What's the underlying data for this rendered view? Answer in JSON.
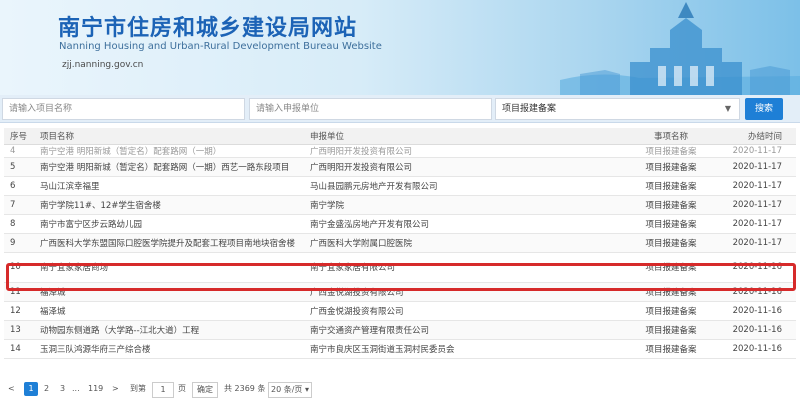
{
  "header": {
    "title_cn": "南宁市住房和城乡建设局网站",
    "title_en": "Nanning Housing and Urban-Rural Development Bureau Website",
    "domain": "zjj.nanning.gov.cn"
  },
  "search": {
    "project_placeholder": "请输入项目名称",
    "unit_placeholder": "请输入申报单位",
    "type_selected": "项目报建备案",
    "button_label": "搜索"
  },
  "table": {
    "columns": [
      "序号",
      "项目名称",
      "申报单位",
      "事项名称",
      "办结时间"
    ],
    "partial_row": {
      "num": "4",
      "project": "南宁空港 明阳新城（暂定名）配套路网（一期）",
      "unit": "广西明阳开发投资有限公司",
      "type": "项目报建备案",
      "date": "2020-11-17"
    },
    "rows": [
      {
        "num": "5",
        "project": "南宁空港 明阳新城（暂定名）配套路网（一期）西艺一路东段项目",
        "unit": "广西明阳开发投资有限公司",
        "type": "项目报建备案",
        "date": "2020-11-17"
      },
      {
        "num": "6",
        "project": "马山江滨幸福里",
        "unit": "马山县园鹏元房地产开发有限公司",
        "type": "项目报建备案",
        "date": "2020-11-17"
      },
      {
        "num": "7",
        "project": "南宁学院11#、12#学生宿舍楼",
        "unit": "南宁学院",
        "type": "项目报建备案",
        "date": "2020-11-17"
      },
      {
        "num": "8",
        "project": "南宁市富宁区步云路幼儿园",
        "unit": "南宁金盛泓房地产开发有限公司",
        "type": "项目报建备案",
        "date": "2020-11-17"
      },
      {
        "num": "9",
        "project": "广西医科大学东盟国际口腔医学院提升及配套工程项目南地块宿舍楼",
        "unit": "广西医科大学附属口腔医院",
        "type": "项目报建备案",
        "date": "2020-11-17"
      },
      {
        "num": "10",
        "project": "南宁宜家家居商场",
        "unit": "南宁宜家家居有限公司",
        "type": "项目报建备案",
        "date": "2020-11-16"
      },
      {
        "num": "11",
        "project": "福泽城",
        "unit": "广西金悦湖投资有限公司",
        "type": "项目报建备案",
        "date": "2020-11-16"
      },
      {
        "num": "12",
        "project": "福泽城",
        "unit": "广西金悦湖投资有限公司",
        "type": "项目报建备案",
        "date": "2020-11-16"
      },
      {
        "num": "13",
        "project": "动物园东侧道路（大学路--江北大道）工程",
        "unit": "南宁交通资产管理有限责任公司",
        "type": "项目报建备案",
        "date": "2020-11-16"
      },
      {
        "num": "14",
        "project": "玉洞三队鸿源华府三产综合楼",
        "unit": "南宁市良庆区玉洞街道玉洞村民委员会",
        "type": "项目报建备案",
        "date": "2020-11-16"
      }
    ]
  },
  "pagination": {
    "prev": "<",
    "pages": [
      "1",
      "2",
      "3"
    ],
    "ellipsis": "...",
    "last_page": "119",
    "next": ">",
    "goto_label": "到第",
    "goto_value": "1",
    "page_unit": "页",
    "confirm_label": "确定",
    "total_text": "共 2369 条",
    "page_size": "20 条/页"
  },
  "colors": {
    "brand_blue": "#1c63b6",
    "accent_button": "#1e7fd6",
    "highlight_red": "#d62a2a"
  }
}
